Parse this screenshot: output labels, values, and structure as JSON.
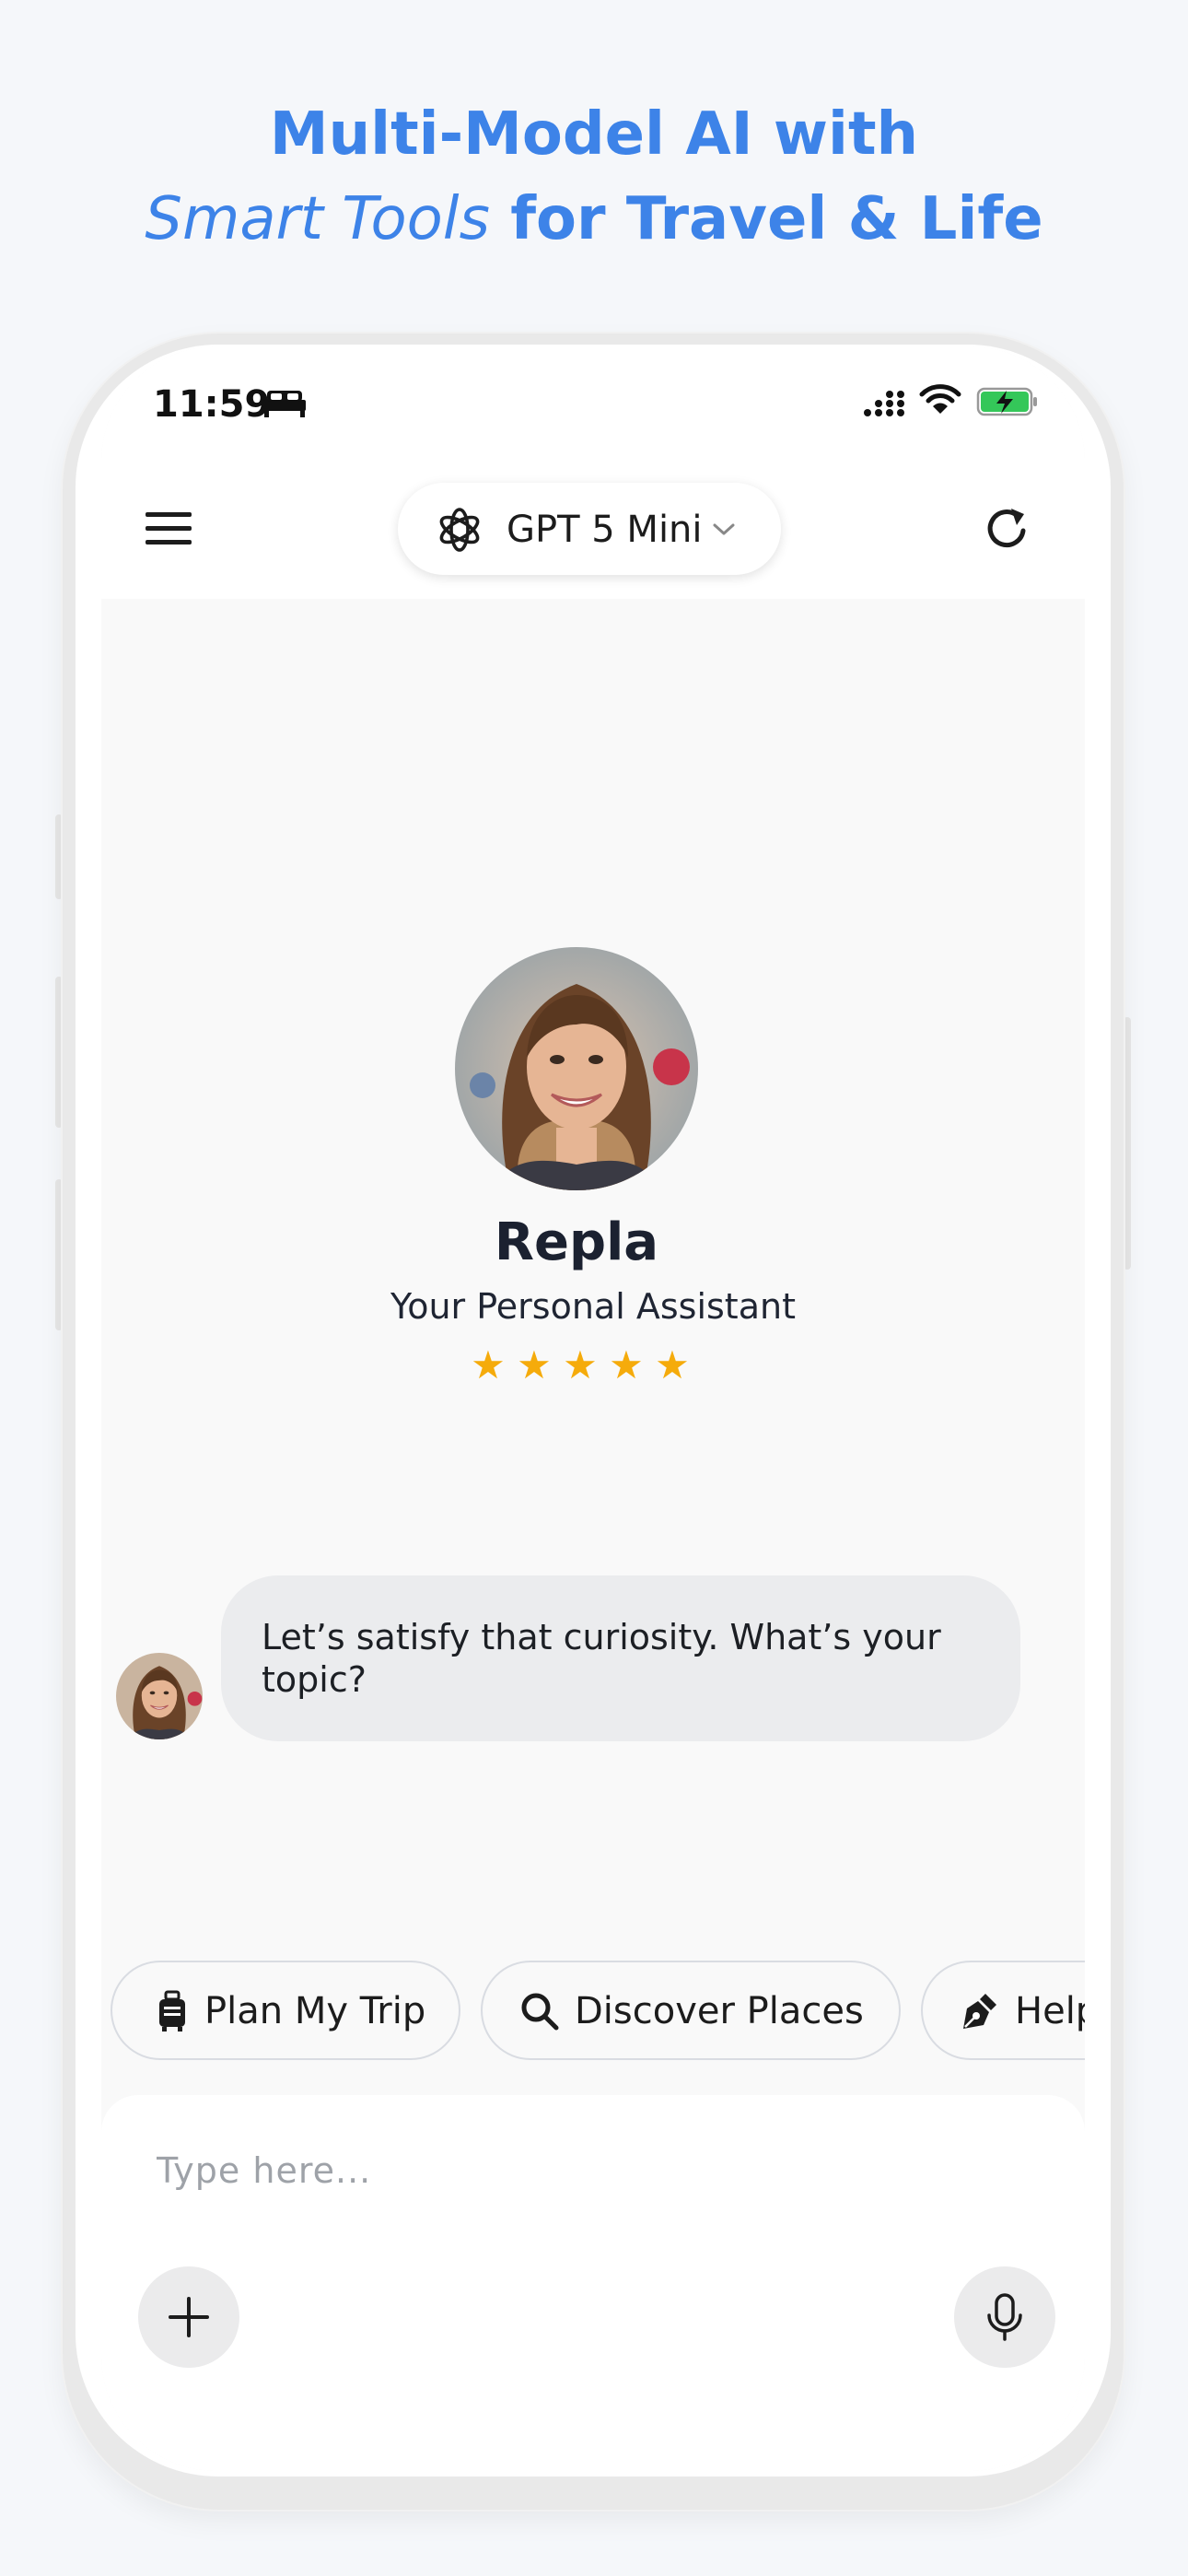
{
  "promo": {
    "line1": "Multi-Model AI with",
    "line2_italic": "Smart Tools",
    "line2_bold": " for Travel & Life"
  },
  "status_bar": {
    "time": "11:59",
    "icons": [
      "sleep-icon",
      "cellular-signal-icon",
      "wifi-icon",
      "battery-charging-icon"
    ]
  },
  "header": {
    "model_name": "GPT 5 Mini",
    "menu_icon": "hamburger-menu-icon",
    "refresh_icon": "refresh-icon"
  },
  "assistant": {
    "name": "Repla",
    "subtitle": "Your Personal Assistant",
    "rating": 5,
    "rating_max": 5
  },
  "chat": {
    "messages": [
      {
        "sender": "assistant",
        "text": "Let’s satisfy that curiosity. What’s your topic?"
      }
    ]
  },
  "quick_actions": [
    {
      "label": "Plan My Trip",
      "icon": "luggage-icon"
    },
    {
      "label": "Discover Places",
      "icon": "search-icon"
    },
    {
      "label": "Help",
      "icon": "pen-nib-icon"
    }
  ],
  "composer": {
    "placeholder": "Type here...",
    "add_icon": "plus-icon",
    "mic_icon": "microphone-icon"
  },
  "colors": {
    "headline": "#3d83e8",
    "star": "#f5ab0b",
    "bubble": "#ebecee"
  }
}
